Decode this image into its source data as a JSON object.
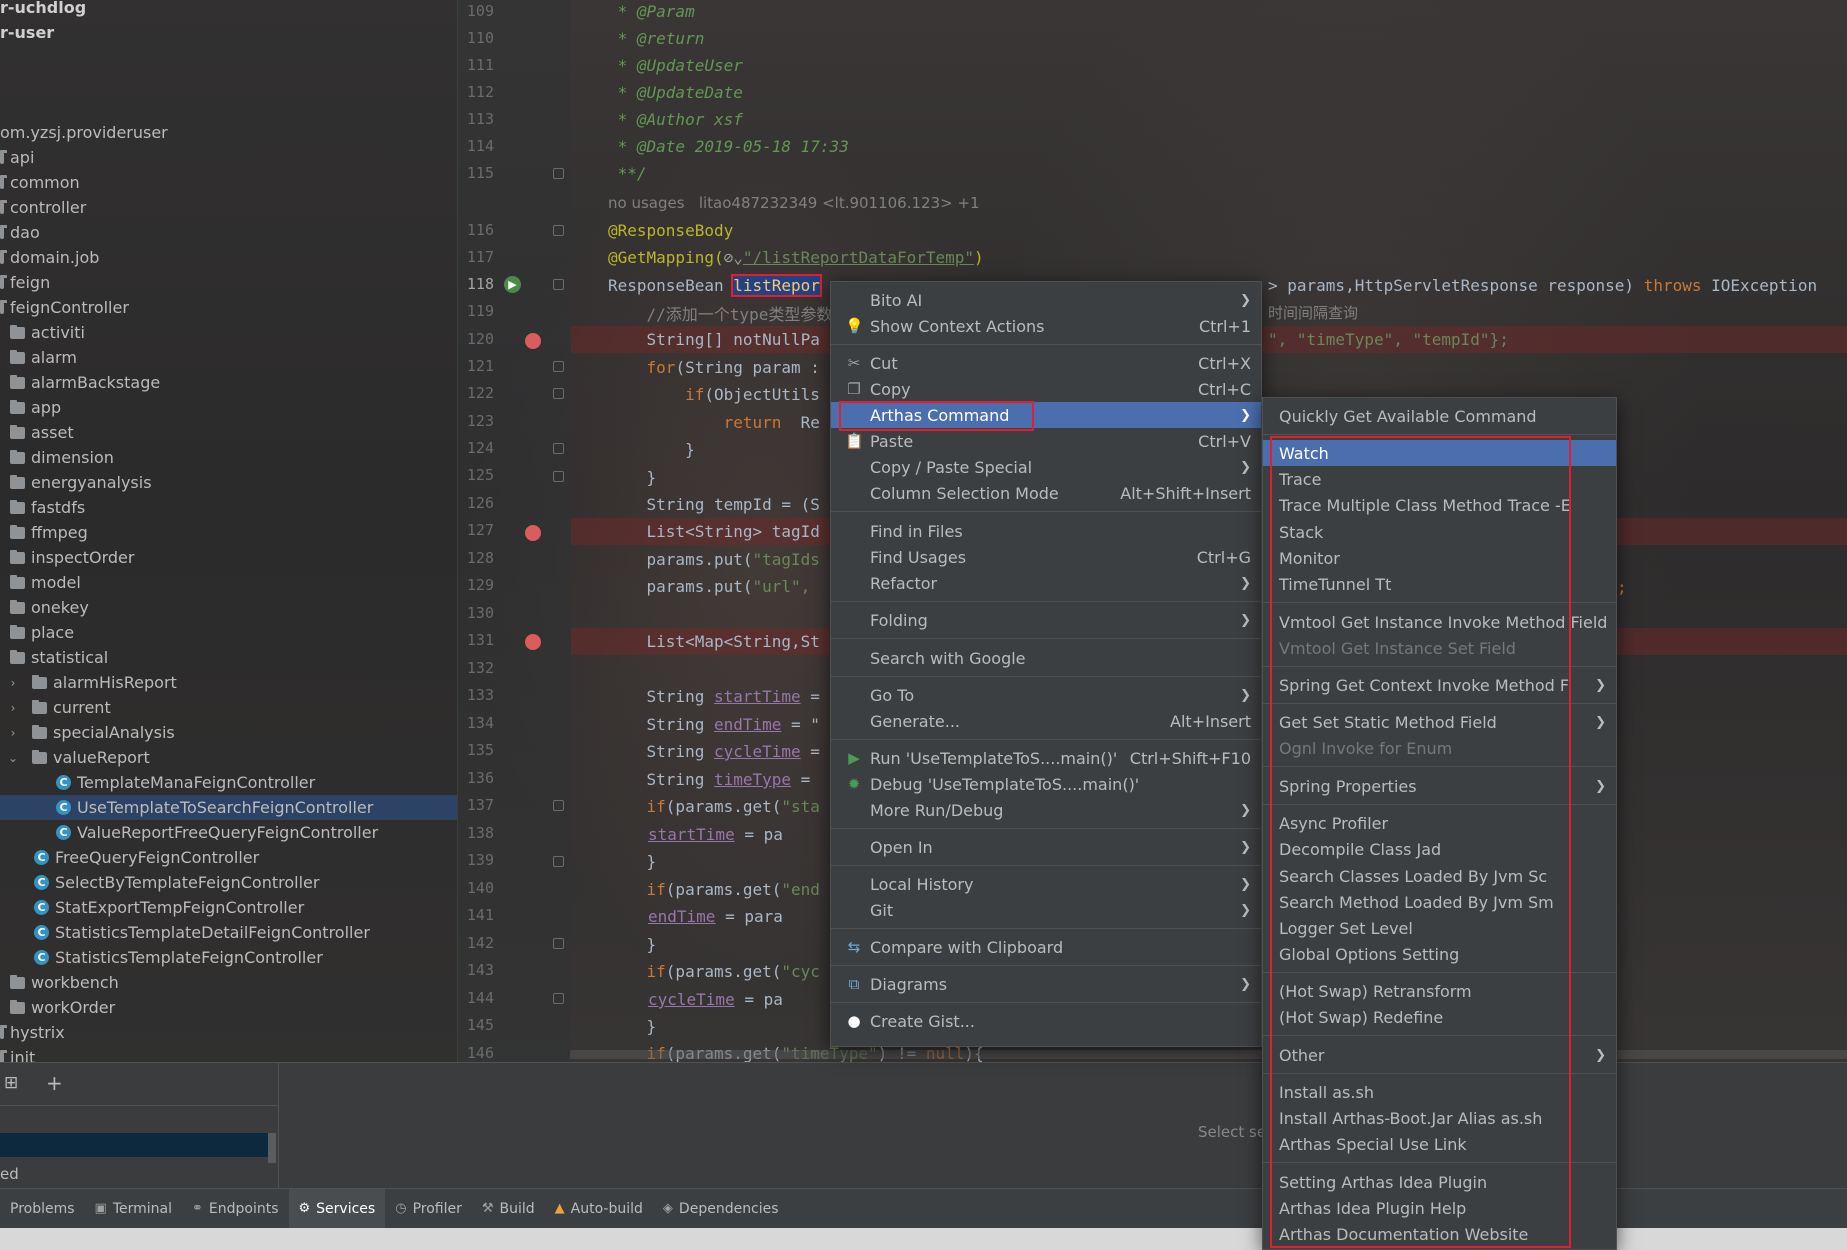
{
  "project_tree": {
    "items": [
      {
        "label": "r-uchdlog",
        "bold": true
      },
      {
        "label": "r-user",
        "bold": true
      },
      {
        "label": "om.yzsj.provideruser"
      },
      {
        "label": "api"
      },
      {
        "label": "common"
      },
      {
        "label": "controller"
      },
      {
        "label": "dao"
      },
      {
        "label": "domain.job"
      },
      {
        "label": "feign"
      },
      {
        "label": "feignController"
      },
      {
        "label": "activiti"
      },
      {
        "label": "alarm"
      },
      {
        "label": "alarmBackstage"
      },
      {
        "label": "app"
      },
      {
        "label": "asset"
      },
      {
        "label": "dimension"
      },
      {
        "label": "energyanalysis"
      },
      {
        "label": "fastdfs"
      },
      {
        "label": "ffmpeg"
      },
      {
        "label": "inspectOrder"
      },
      {
        "label": "model"
      },
      {
        "label": "onekey"
      },
      {
        "label": "place"
      },
      {
        "label": "statistical"
      },
      {
        "label": "alarmHisReport"
      },
      {
        "label": "current"
      },
      {
        "label": "specialAnalysis"
      },
      {
        "label": "valueReport"
      },
      {
        "label": "TemplateManaFeignController"
      },
      {
        "label": "UseTemplateToSearchFeignController"
      },
      {
        "label": "ValueReportFreeQueryFeignController"
      },
      {
        "label": "FreeQueryFeignController"
      },
      {
        "label": "SelectByTemplateFeignController"
      },
      {
        "label": "StatExportTempFeignController"
      },
      {
        "label": "StatisticsTemplateDetailFeignController"
      },
      {
        "label": "StatisticsTemplateFeignController"
      },
      {
        "label": "workbench"
      },
      {
        "label": "workOrder"
      },
      {
        "label": "hystrix"
      },
      {
        "label": "init"
      }
    ]
  },
  "editor": {
    "line_numbers": [
      "109",
      "110",
      "111",
      "112",
      "113",
      "114",
      "115",
      "116",
      "117",
      "118",
      "119",
      "120",
      "121",
      "122",
      "123",
      "124",
      "125",
      "126",
      "127",
      "128",
      "129",
      "130",
      "131",
      "132",
      "133",
      "134",
      "135",
      "136",
      "137",
      "138",
      "139",
      "140",
      "141",
      "142",
      "143",
      "144",
      "145",
      "146"
    ],
    "code": {
      "l109": " * @Param",
      "l110": " * @return",
      "l111": " * @UpdateUser",
      "l112": " * @UpdateDate",
      "l113": " * @Author xsf",
      "l114": " * @Date 2019-05-18 17:33",
      "l115": " **/",
      "hint": "no usages   litao487232349 <lt.901106.123> +1",
      "l116": "@ResponseBody",
      "l117_pre": "@GetMapping(",
      "l117_icon": "⊘⌄",
      "l117_str": "\"/listReportDataForTemp\"",
      "l117_post": ")",
      "l118_pre": "ResponseBean ",
      "l118_sel": "listRepor",
      "l118_right": "> params,HttpServletResponse response) ",
      "l118_throws": "throws",
      "l118_exc": " IOException",
      "l119": "    //添加一个type类型参数",
      "l119_right": "时间间隔查询",
      "l120": "    String[] notNullPa",
      "l120_right": "\", \"timeType\", \"tempId\"};",
      "l121_k": "    for",
      "l121": "(String param :",
      "l122_k": "        if",
      "l122": "(ObjectUtils",
      "l123_k": "            return",
      "l123": "  Re",
      "l124": "        }",
      "l125": "    }",
      "l126": "    String tempId = (S",
      "l127": "    List<String> tagId",
      "l128": "    params.put(",
      "l128_s": "\"tagIds",
      "l129": "    params.put(",
      "l129_s": "\"url\",",
      "l129_right": ";",
      "l130": "",
      "l131": "    List<Map<String,St",
      "l132": "",
      "l133_a": "    String ",
      "l133_f": "startTime",
      "l133_b": " = ",
      "l134_a": "    String ",
      "l134_f": "endTime",
      "l134_b": " = \"",
      "l135_a": "    String ",
      "l135_f": "cycleTime",
      "l135_b": " =",
      "l136_a": "    String ",
      "l136_f": "timeType",
      "l136_b": " =",
      "l137_k": "    if",
      "l137": "(params.get(",
      "l137_s": "\"sta",
      "l138_f": "startTime",
      "l138": " = pa",
      "l139": "    }",
      "l140_k": "    if",
      "l140": "(params.get(",
      "l140_s": "\"end",
      "l141_f": "endTime",
      "l141": " = para",
      "l142": "    }",
      "l143_k": "    if",
      "l143": "(params.get(",
      "l143_s": "\"cyc",
      "l144_f": "cycleTime",
      "l144": " = pa",
      "l145": "    }",
      "l146_k": "    if",
      "l146": "(params.get(",
      "l146_s": "\"timeType\"",
      "l146_b": ") != ",
      "l146_null": "null",
      "l146_c": "){"
    }
  },
  "bottom_panel": {
    "row_text": "ed",
    "right_text": "Select se",
    "tabs": [
      {
        "label": "Problems",
        "icon": "problems-icon"
      },
      {
        "label": "Terminal",
        "icon": "terminal-icon"
      },
      {
        "label": "Endpoints",
        "icon": "endpoints-icon"
      },
      {
        "label": "Services",
        "icon": "services-icon",
        "active": true
      },
      {
        "label": "Profiler",
        "icon": "profiler-icon"
      },
      {
        "label": "Build",
        "icon": "build-icon"
      },
      {
        "label": "Auto-build",
        "icon": "warning-icon"
      },
      {
        "label": "Dependencies",
        "icon": "dependencies-icon"
      }
    ]
  },
  "context_menu": {
    "items": [
      {
        "label": "Bito AI",
        "shortcut": "",
        "submenu": true
      },
      {
        "label": "Show Context Actions",
        "shortcut": "Ctrl+1",
        "icon": "lightbulb-icon"
      },
      {
        "label": "Cut",
        "shortcut": "Ctrl+X",
        "icon": "scissors-icon"
      },
      {
        "label": "Copy",
        "shortcut": "Ctrl+C",
        "icon": "copy-icon"
      },
      {
        "label": "Arthas Command",
        "shortcut": "",
        "submenu": true,
        "highlighted": true
      },
      {
        "label": "Paste",
        "shortcut": "Ctrl+V",
        "icon": "paste-icon"
      },
      {
        "label": "Copy / Paste Special",
        "shortcut": "",
        "submenu": true
      },
      {
        "label": "Column Selection Mode",
        "shortcut": "Alt+Shift+Insert"
      },
      {
        "label": "Find in Files",
        "shortcut": ""
      },
      {
        "label": "Find Usages",
        "shortcut": "Ctrl+G"
      },
      {
        "label": "Refactor",
        "shortcut": "",
        "submenu": true
      },
      {
        "label": "Folding",
        "shortcut": "",
        "submenu": true
      },
      {
        "label": "Search with Google",
        "shortcut": ""
      },
      {
        "label": "Go To",
        "shortcut": "",
        "submenu": true
      },
      {
        "label": "Generate...",
        "shortcut": "Alt+Insert"
      },
      {
        "label": "Run 'UseTemplateToS....main()'",
        "shortcut": "Ctrl+Shift+F10",
        "icon": "run-icon"
      },
      {
        "label": "Debug 'UseTemplateToS....main()'",
        "shortcut": "",
        "icon": "debug-icon"
      },
      {
        "label": "More Run/Debug",
        "shortcut": "",
        "submenu": true
      },
      {
        "label": "Open In",
        "shortcut": "",
        "submenu": true
      },
      {
        "label": "Local History",
        "shortcut": "",
        "submenu": true
      },
      {
        "label": "Git",
        "shortcut": "",
        "submenu": true
      },
      {
        "label": "Compare with Clipboard",
        "shortcut": "",
        "icon": "compare-icon"
      },
      {
        "label": "Diagrams",
        "shortcut": "",
        "submenu": true,
        "icon": "diagram-icon"
      },
      {
        "label": "Create Gist...",
        "shortcut": "",
        "icon": "github-icon"
      }
    ]
  },
  "arthas_menu": {
    "items": [
      {
        "label": "Quickly Get Available Command"
      },
      {
        "label": "Watch",
        "highlighted": true
      },
      {
        "label": "Trace"
      },
      {
        "label": "Trace Multiple Class Method Trace -E"
      },
      {
        "label": "Stack"
      },
      {
        "label": "Monitor"
      },
      {
        "label": "TimeTunnel Tt"
      },
      {
        "label": "Vmtool Get Instance Invoke Method Field"
      },
      {
        "label": "Vmtool Get Instance Set Field",
        "disabled": true
      },
      {
        "label": "Spring Get Context Invoke Method Field",
        "submenu": true
      },
      {
        "label": "Get Set Static Method Field",
        "submenu": true
      },
      {
        "label": "Ognl Invoke for Enum",
        "disabled": true
      },
      {
        "label": "Spring Properties",
        "submenu": true
      },
      {
        "label": "Async Profiler"
      },
      {
        "label": "Decompile Class Jad"
      },
      {
        "label": "Search Classes Loaded By Jvm Sc"
      },
      {
        "label": "Search Method Loaded By Jvm Sm"
      },
      {
        "label": "Logger Set Level"
      },
      {
        "label": "Global Options Setting"
      },
      {
        "label": "(Hot Swap) Retransform"
      },
      {
        "label": "(Hot Swap) Redefine"
      },
      {
        "label": "Other",
        "submenu": true
      },
      {
        "label": "Install as.sh"
      },
      {
        "label": "Install Arthas-Boot.Jar Alias as.sh"
      },
      {
        "label": "Arthas Special Use Link"
      },
      {
        "label": "Setting Arthas Idea Plugin"
      },
      {
        "label": "Arthas Idea Plugin Help"
      },
      {
        "label": "Arthas Documentation Website"
      }
    ]
  }
}
